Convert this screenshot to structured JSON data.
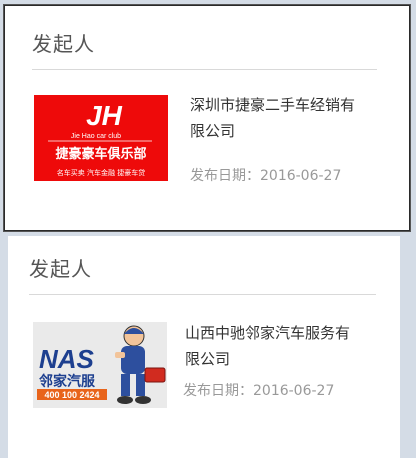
{
  "cards": [
    {
      "title": "发起人",
      "logo": {
        "brand_mark": "JH",
        "brand_en": "Jie Hao car club",
        "brand_cn": "捷豪豪车俱乐部",
        "tagline": "名车买卖 汽车金融 捷豪车贷",
        "bg_color": "#ee0a0a"
      },
      "company_name": "深圳市捷豪二手车经销有限公司",
      "publish_date": "发布日期：2016-06-27"
    },
    {
      "title": "发起人",
      "logo": {
        "brand_mark": "NAS",
        "brand_cn": "邻家汽服",
        "phone": "400 100 2424",
        "mascot_icon": "mechanic-mascot-icon",
        "bg_color": "#eaeaea"
      },
      "company_name": "山西中驰邻家汽车服务有限公司",
      "publish_date": "发布日期：2016-06-27"
    }
  ]
}
